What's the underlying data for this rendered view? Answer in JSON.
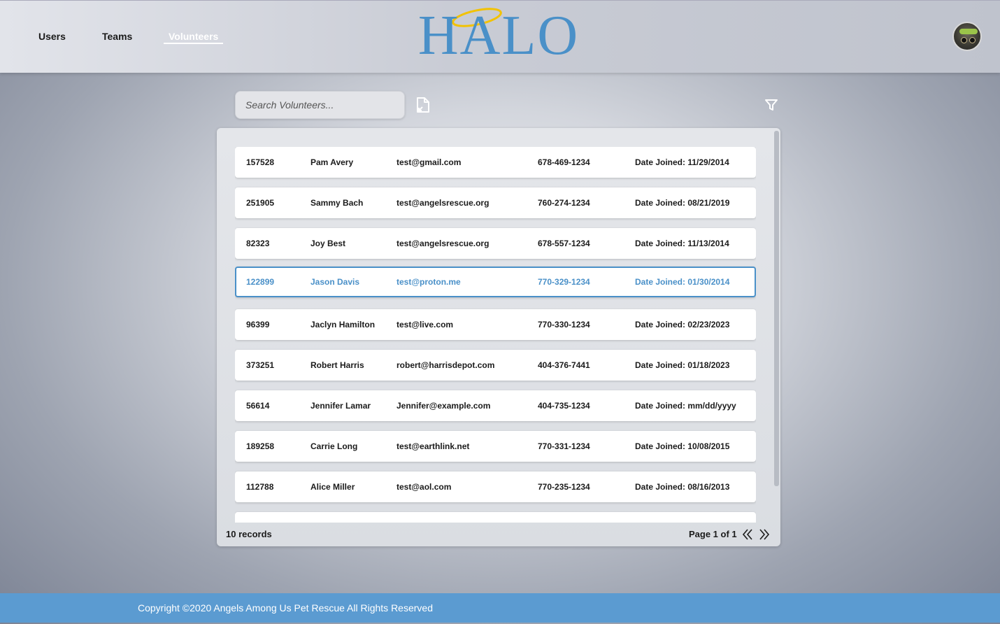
{
  "nav": {
    "items": [
      {
        "label": "Users",
        "active": false
      },
      {
        "label": "Teams",
        "active": false
      },
      {
        "label": "Volunteers",
        "active": true
      }
    ]
  },
  "logo": {
    "text": "HALO",
    "accent_color": "#4a90c8",
    "halo_color": "#f2c200"
  },
  "avatar": {
    "icon": "user-avatar"
  },
  "search": {
    "placeholder": "Search Volunteers...",
    "value": ""
  },
  "toolbar": {
    "export_icon": "document-export-icon",
    "filter_icon": "filter-icon"
  },
  "volunteers": [
    {
      "id": "157528",
      "name": "Pam Avery",
      "email": "test@gmail.com",
      "phone": "678-469-1234",
      "date": "Date Joined: 11/29/2014",
      "selected": false
    },
    {
      "id": "251905",
      "name": "Sammy Bach",
      "email": "test@angelsrescue.org",
      "phone": "760-274-1234",
      "date": "Date Joined: 08/21/2019",
      "selected": false
    },
    {
      "id": "82323",
      "name": "Joy Best",
      "email": "test@angelsrescue.org",
      "phone": "678-557-1234",
      "date": "Date Joined: 11/13/2014",
      "selected": false
    },
    {
      "id": "122899",
      "name": "Jason Davis",
      "email": "test@proton.me",
      "phone": "770-329-1234",
      "date": "Date Joined: 01/30/2014",
      "selected": true
    },
    {
      "id": "96399",
      "name": "Jaclyn Hamilton",
      "email": "test@live.com",
      "phone": "770-330-1234",
      "date": "Date Joined: 02/23/2023",
      "selected": false
    },
    {
      "id": "373251",
      "name": "Robert Harris",
      "email": "robert@harrisdepot.com",
      "phone": "404-376-7441",
      "date": "Date Joined: 01/18/2023",
      "selected": false
    },
    {
      "id": "56614",
      "name": "Jennifer Lamar",
      "email": "Jennifer@example.com",
      "phone": "404-735-1234",
      "date": "Date Joined: mm/dd/yyyy",
      "selected": false
    },
    {
      "id": "189258",
      "name": "Carrie Long",
      "email": "test@earthlink.net",
      "phone": "770-331-1234",
      "date": "Date Joined: 10/08/2015",
      "selected": false
    },
    {
      "id": "112788",
      "name": "Alice Miller",
      "email": "test@aol.com",
      "phone": "770-235-1234",
      "date": "Date Joined: 08/16/2013",
      "selected": false
    },
    {
      "id": "",
      "name": "",
      "email": "",
      "phone": "",
      "date": "",
      "selected": false
    }
  ],
  "pagination": {
    "records_label": "10 records",
    "page_label": "Page 1 of 1"
  },
  "footer": {
    "copyright": "Copyright ©2020 Angels Among Us Pet Rescue All Rights Reserved"
  }
}
